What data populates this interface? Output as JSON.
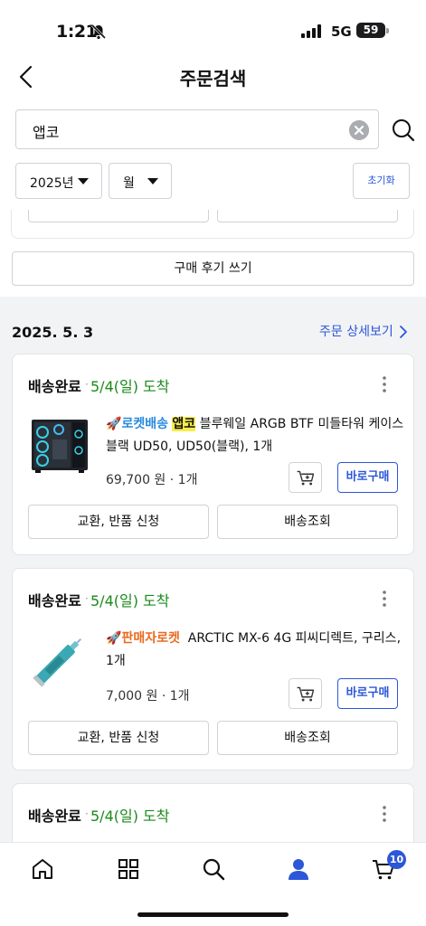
{
  "status_bar": {
    "time": "1:21",
    "network": "5G",
    "battery": "59"
  },
  "header": {
    "title": "주문검색"
  },
  "search": {
    "query": "앱코",
    "year_select": "2025년",
    "month_select": "월",
    "reset_label": "초기화"
  },
  "previous_card": {
    "review_button": "구매 후기 쓰기"
  },
  "order_group": {
    "date": "2025. 5. 3",
    "detail_link": "주문 상세보기"
  },
  "orders": [
    {
      "status": "배송완료",
      "separator": "·",
      "arrival": "5/4(일) 도착",
      "badge": "로켓배송",
      "highlight": "앱코",
      "name": "블루웨일 ARGB BTF 미들타워 케이스 블랙 UD50, UD50(블랙), 1개",
      "price": "69,700 원 · 1개",
      "buy_label": "바로구매",
      "exchange_label": "교환, 반품 신청",
      "tracking_label": "배송조회"
    },
    {
      "status": "배송완료",
      "separator": "·",
      "arrival": "5/4(일) 도착",
      "badge": "판매자로켓",
      "name": "ARCTIC MX-6 4G 피씨디렉트, 구리스, 1개",
      "price": "7,000 원 · 1개",
      "buy_label": "바로구매",
      "exchange_label": "교환, 반품 신청",
      "tracking_label": "배송조회"
    },
    {
      "status": "배송완료",
      "separator": "·",
      "arrival": "5/4(일) 도착"
    }
  ],
  "tab_bar": {
    "cart_count": "10",
    "icons": [
      "home-icon",
      "category-icon",
      "search-icon",
      "my-page-icon",
      "cart-icon"
    ]
  },
  "colors": {
    "accent": "#2b57d8",
    "arrival_green": "#1a8a1a",
    "rocket_blue": "#2a8adf",
    "seller_orange": "#ea6a1e",
    "highlight_yellow": "#f8ed4b"
  }
}
